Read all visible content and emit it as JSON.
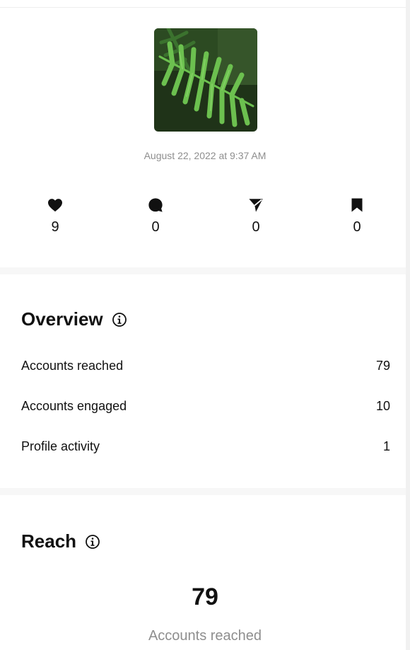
{
  "post": {
    "thumbnail_icon": "fern-photo-thumbnail",
    "timestamp": "August 22, 2022 at 9:37 AM"
  },
  "stats": [
    {
      "icon": "heart-icon",
      "value": "9"
    },
    {
      "icon": "comment-icon",
      "value": "0"
    },
    {
      "icon": "share-icon",
      "value": "0"
    },
    {
      "icon": "bookmark-icon",
      "value": "0"
    }
  ],
  "overview": {
    "title": "Overview",
    "info_icon": "info-icon",
    "rows": [
      {
        "label": "Accounts reached",
        "value": "79"
      },
      {
        "label": "Accounts engaged",
        "value": "10"
      },
      {
        "label": "Profile activity",
        "value": "1"
      }
    ]
  },
  "reach": {
    "title": "Reach",
    "info_icon": "info-icon",
    "value": "79",
    "label": "Accounts reached"
  },
  "colors": {
    "text": "#111111",
    "muted": "#8e8e8e",
    "divider": "#f7f7f7",
    "fern_green": "#5fae45"
  }
}
